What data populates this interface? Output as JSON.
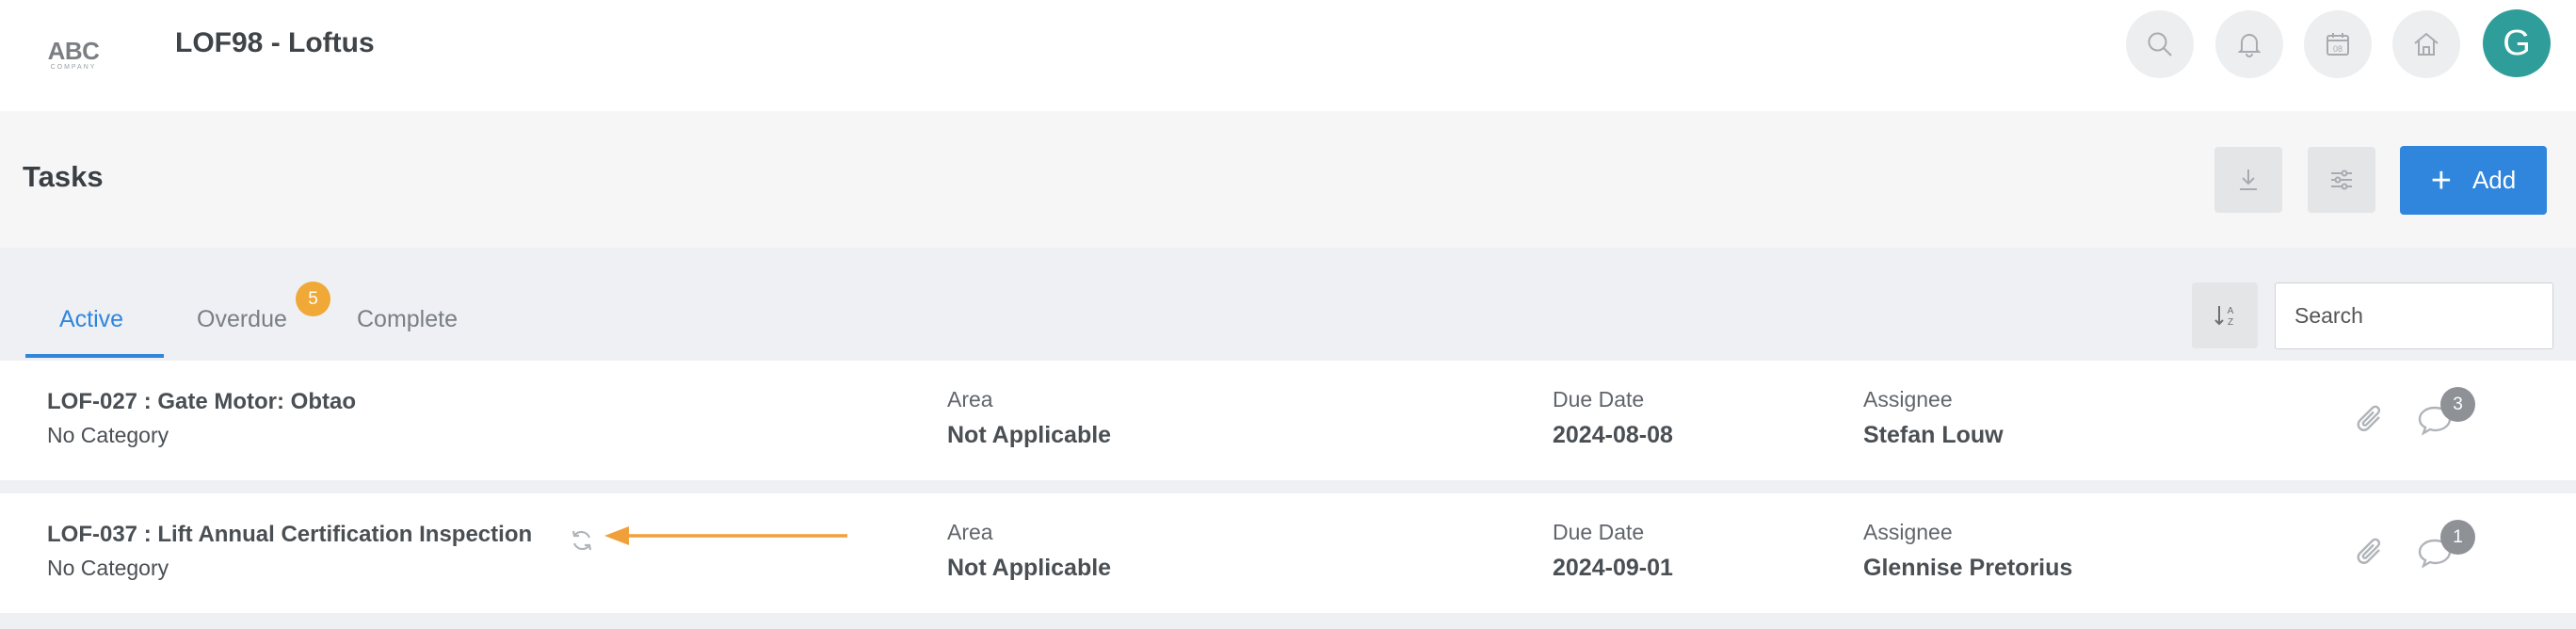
{
  "brand": {
    "logo_text": "ABC",
    "logo_subtext": "COMPANY"
  },
  "header": {
    "site_title": "LOF98 - Loftus",
    "avatar_initial": "G"
  },
  "top_icons": [
    "search-icon",
    "bell-icon",
    "calendar-icon",
    "home-icon"
  ],
  "calendar_day": "08",
  "page": {
    "title": "Tasks",
    "add_label": "Add"
  },
  "tabs": [
    {
      "label": "Active",
      "active": true
    },
    {
      "label": "Overdue",
      "badge": "5"
    },
    {
      "label": "Complete"
    }
  ],
  "search": {
    "placeholder": "Search"
  },
  "columns": {
    "area": "Area",
    "due": "Due Date",
    "assignee": "Assignee"
  },
  "tasks": [
    {
      "title": "LOF-027 : Gate Motor: Obtao",
      "category": "No Category",
      "area": "Not Applicable",
      "due_date": "2024-08-08",
      "assignee": "Stefan Louw",
      "comments": "3",
      "recurring": false
    },
    {
      "title": "LOF-037 : Lift Annual Certification Inspection",
      "category": "No Category",
      "area": "Not Applicable",
      "due_date": "2024-09-01",
      "assignee": "Glennise Pretorius",
      "comments": "1",
      "recurring": true
    }
  ],
  "colors": {
    "accent": "#2f86dc",
    "badge_orange": "#f0a836",
    "avatar": "#2f9e9a",
    "annotation_arrow": "#f0a03a"
  }
}
